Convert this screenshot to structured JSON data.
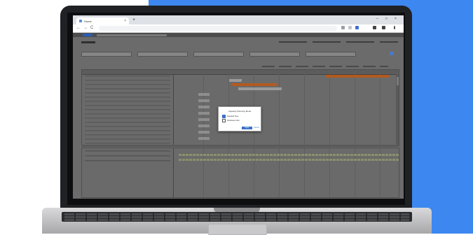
{
  "colors": {
    "background_blue": "#3d88f0",
    "accent_orange": "#c8611f",
    "bar_gray": "#9a9a9a",
    "primary_button": "#3c6fc6"
  },
  "browser": {
    "tab_title": "Home",
    "new_tab_label": "+",
    "close_tab_label": "×",
    "minimize_label": "–",
    "maximize_label": "□",
    "close_window_label": "×",
    "back_icon": "←",
    "forward_icon": "→",
    "reload_icon": "C"
  },
  "dialog": {
    "title": "Capacity Planning Mode",
    "options": [
      {
        "label": "Standard View",
        "selected": true
      },
      {
        "label": "Shadowed Jobs",
        "selected": false
      }
    ],
    "apply_label": "Apply",
    "cancel_label": "Cancel"
  }
}
